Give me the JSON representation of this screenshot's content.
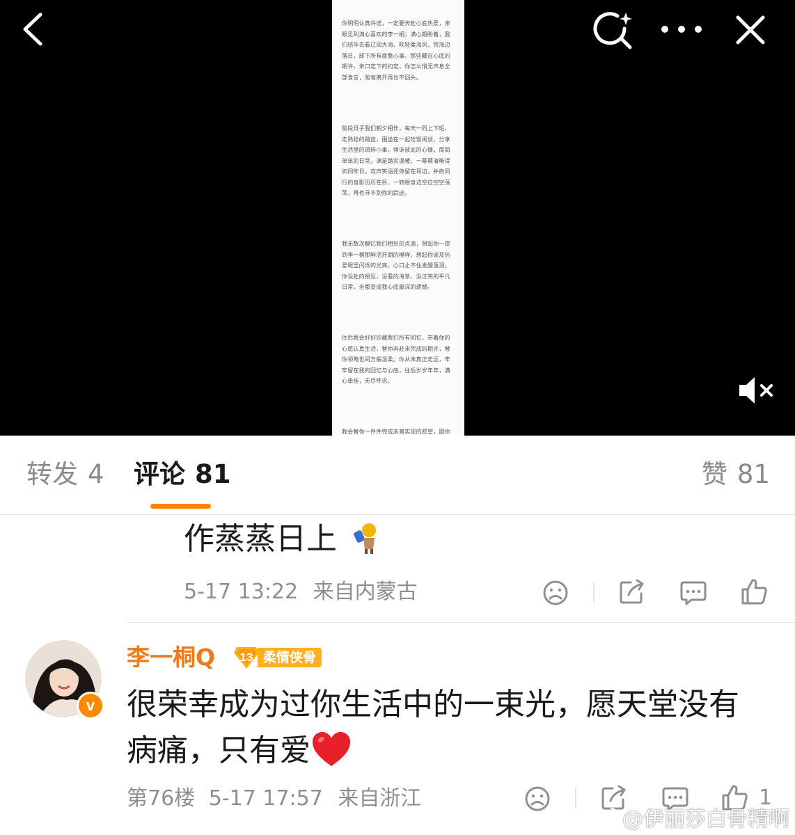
{
  "media": {
    "doc_paragraphs": [
      "你明明认真许诺，一定要奔赴心底热爱，亲眼见到满心喜欢的李一桐；满心期盼着，我们结伴去看辽阔大海，吹轻柔海风，赏海边落日，卸下所有疲惫心事。那些藏在心底的期许，亲口定下的约定，你怎么悄无声息全部食言，匆匆离开再也不回头。",
      "前段日子我们朝夕相伴，每天一同上下班，走熟稔的路途，围坐在一起吃饭闲谈，分享生活里的琐碎小事，倾诉彼此的心情。简简单单的日常，满是踏实温暖，一幕幕清晰得如同昨日。欢声笑语还停留在耳边，并肩同行的身影历历在目，一转眼身边空位空空荡荡，再也寻不到你的踪迹。",
      "我无数次翻忆我们相处的点滴，想起你一提到李一桐那鲜活开朗的模样，想起你谈及热爱眼里闪烁的光亮，心口止不住发酸落泪。你没赴的相见，没看的海景，没过完的平凡日常，全都变成我心底最深的遗憾。",
      "往后我会好好珍藏我们所有回忆，带着你的心愿认真生活，替你奔赴未完成的期许，替你领略世间万般温柔。你从未真正走远，牢牢留在我的回忆与心底，往后岁岁年年，满心牵挂，无尽怀念。",
      "我会替你一件件完成未曾实现的愿望，圆你"
    ]
  },
  "tabs": {
    "repost_label": "转发",
    "repost_count": "4",
    "comment_label": "评论",
    "comment_count": "81",
    "like_label": "赞",
    "like_count": "81"
  },
  "comments": [
    {
      "text": "作蒸蒸日上",
      "date": "5-17 13:22",
      "location": "来自内蒙古"
    },
    {
      "username": "李一桐Q",
      "level": "13",
      "level_title": "柔情侠骨",
      "verified_mark": "v",
      "text": "很荣幸成为过你生活中的一束光，愿天堂没有病痛，只有爱",
      "floor": "第76楼",
      "date": "5-17 17:57",
      "location": "来自浙江",
      "like_count": "1"
    }
  ],
  "watermark": "@伊丽莎白骨精啊",
  "colors": {
    "accent": "#ff8200",
    "username": "#ee7b1b",
    "level_badge": "#ffb020",
    "meta_gray": "#8f8f8f"
  }
}
